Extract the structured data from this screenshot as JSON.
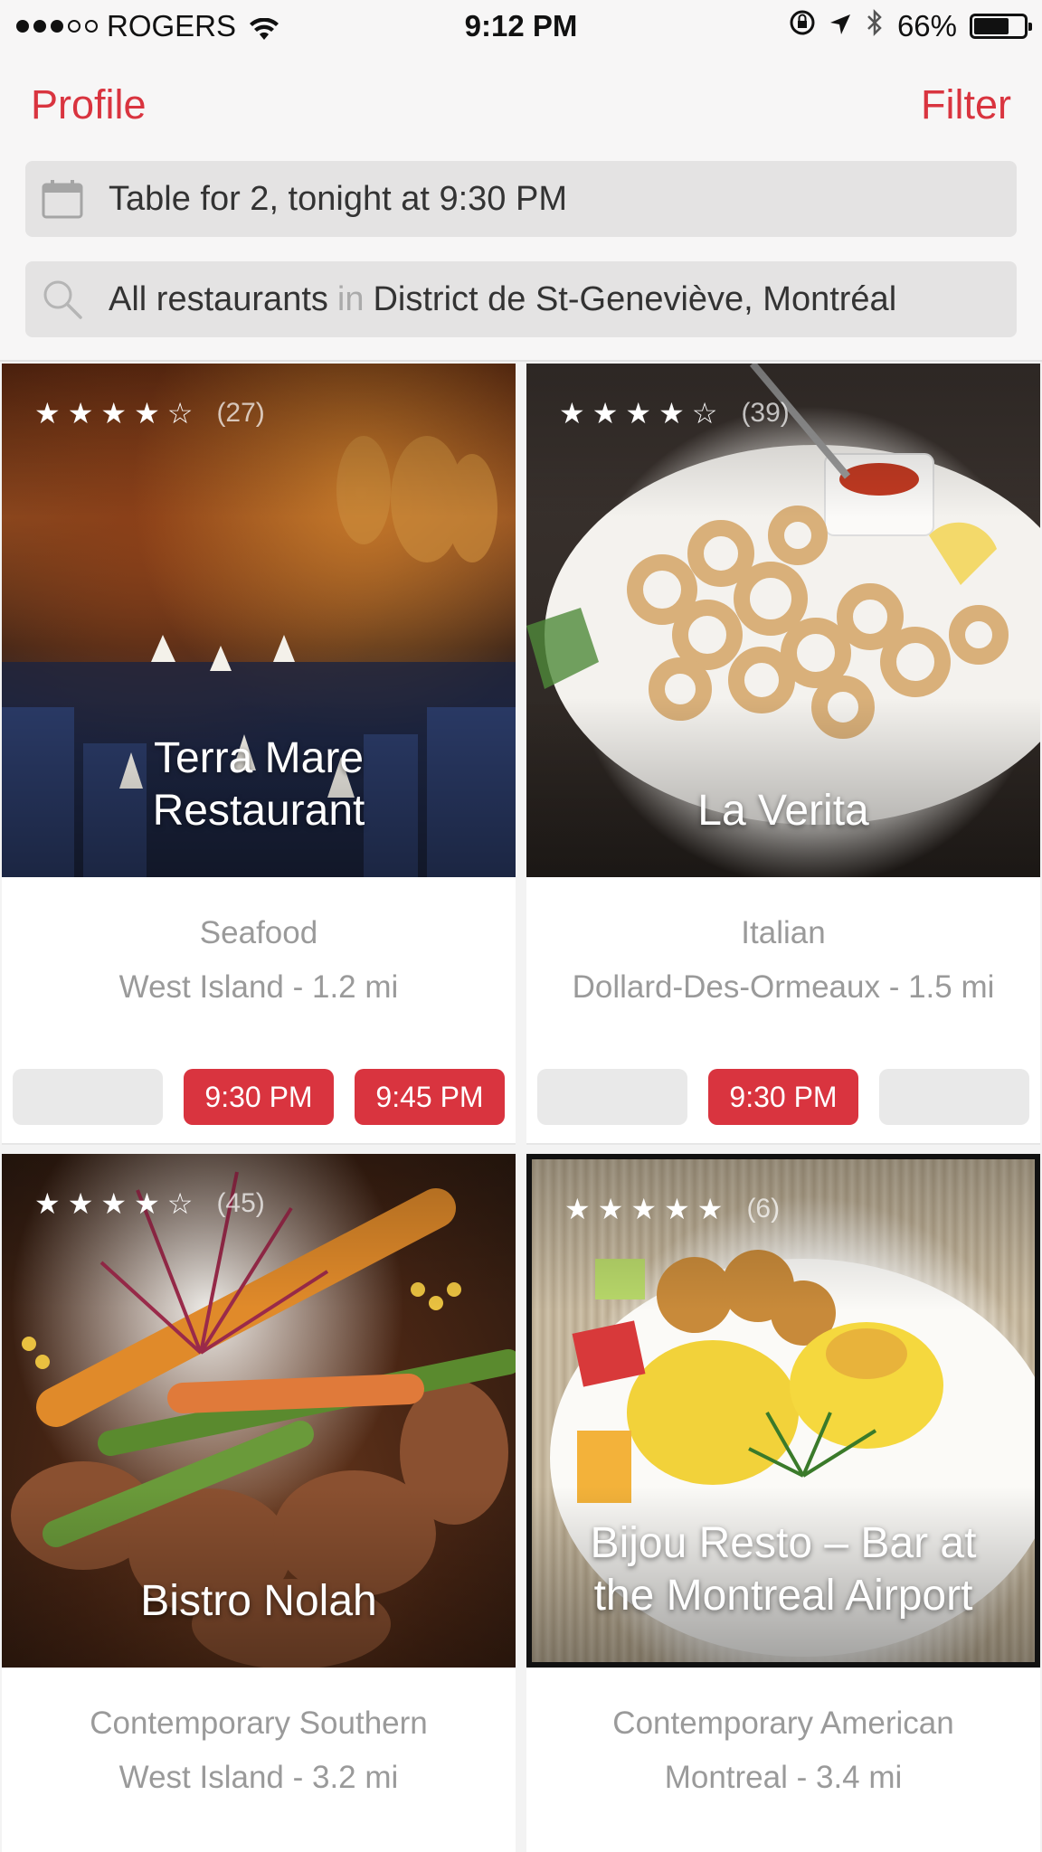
{
  "status_bar": {
    "carrier": "ROGERS",
    "time": "9:12 PM",
    "battery": "66%",
    "battery_level": 0.66
  },
  "header": {
    "profile_label": "Profile",
    "filter_label": "Filter",
    "reservation_text": "Table for 2, tonight at 9:30 PM",
    "location": {
      "scope": "All restaurants",
      "connector": "in",
      "place": "District de St-Geneviève, Montréal"
    }
  },
  "restaurants": [
    {
      "name_line1": "Terra Mare",
      "name_line2": "Restaurant",
      "rating": 4.5,
      "reviews": "(27)",
      "cuisine": "Seafood",
      "area": "West Island - 1.2 mi",
      "times": [
        "",
        "9:30 PM",
        "9:45 PM"
      ]
    },
    {
      "name_line1": "La Verita",
      "name_line2": "",
      "rating": 4.5,
      "reviews": "(39)",
      "cuisine": "Italian",
      "area": "Dollard-Des-Ormeaux - 1.5 mi",
      "times": [
        "",
        "9:30 PM",
        ""
      ]
    },
    {
      "name_line1": "Bistro Nolah",
      "name_line2": "",
      "rating": 4.5,
      "reviews": "(45)",
      "cuisine": "Contemporary Southern",
      "area": "West Island - 3.2 mi"
    },
    {
      "name_line1": "Bijou Resto – Bar at",
      "name_line2": "the Montreal Airport",
      "rating": 5,
      "reviews": "(6)",
      "cuisine": "Contemporary American",
      "area": "Montreal - 3.4 mi"
    }
  ],
  "colors": {
    "accent": "#d9343f",
    "muted_text": "#9a9a9a",
    "field_bg": "#e4e3e3"
  }
}
